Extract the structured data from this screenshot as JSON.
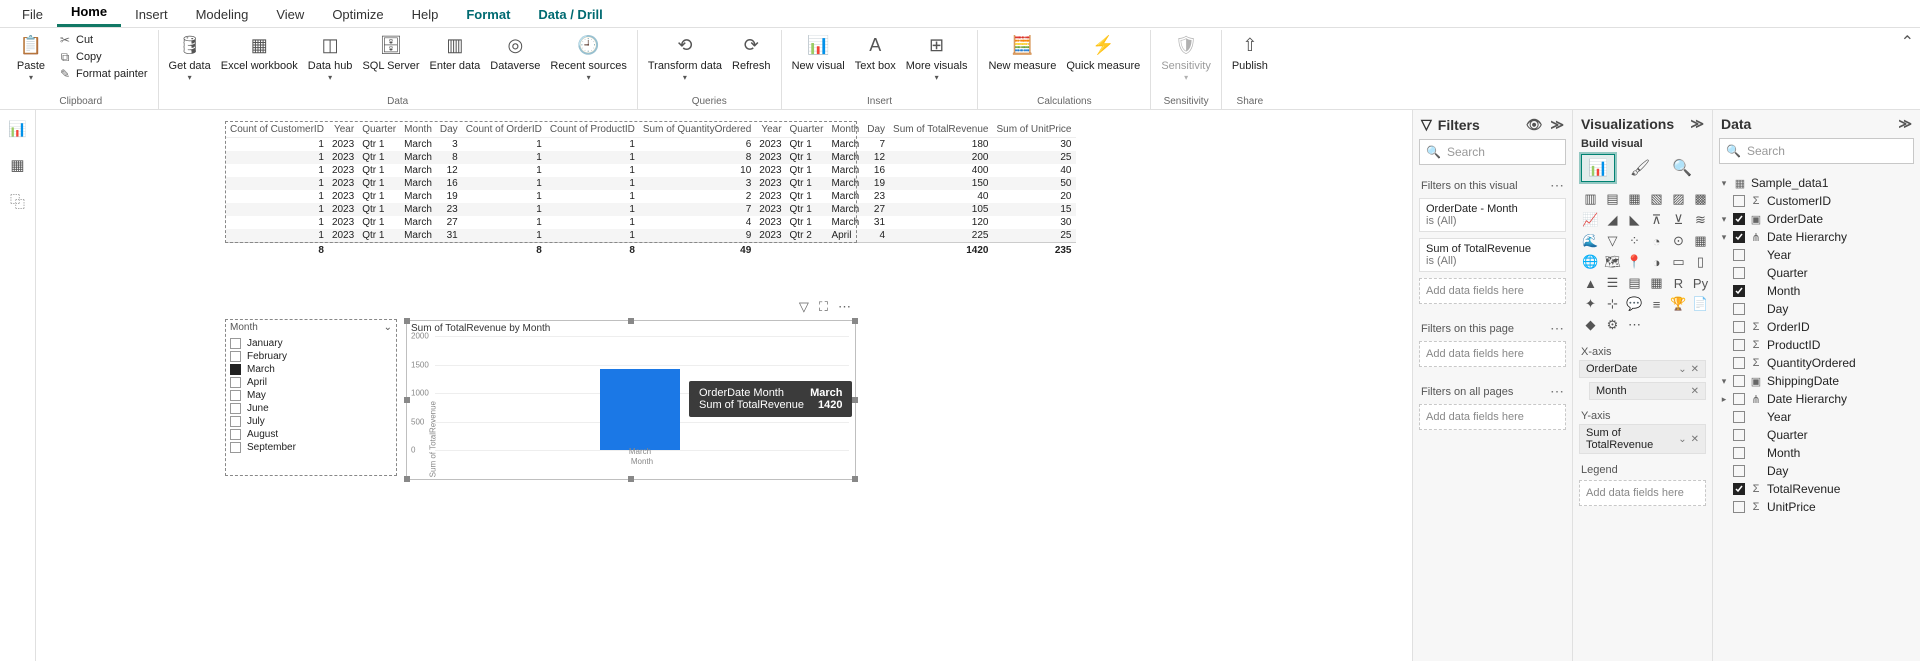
{
  "ribbon_tabs": {
    "file": "File",
    "home": "Home",
    "insert": "Insert",
    "modeling": "Modeling",
    "view": "View",
    "optimize": "Optimize",
    "help": "Help",
    "format": "Format",
    "data_drill": "Data / Drill"
  },
  "ribbon": {
    "paste": "Paste",
    "cut": "Cut",
    "copy": "Copy",
    "format_painter": "Format painter",
    "clipboard": "Clipboard",
    "get_data": "Get data",
    "excel": "Excel workbook",
    "data_hub": "Data hub",
    "sql_server": "SQL Server",
    "enter_data": "Enter data",
    "dataverse": "Dataverse",
    "recent_sources": "Recent sources",
    "data_group": "Data",
    "transform_data": "Transform data",
    "refresh": "Refresh",
    "queries": "Queries",
    "new_visual": "New visual",
    "text_box": "Text box",
    "more_visuals": "More visuals",
    "insert_group": "Insert",
    "new_measure": "New measure",
    "quick_measure": "Quick measure",
    "calculations": "Calculations",
    "sensitivity": "Sensitivity",
    "sensitivity_group": "Sensitivity",
    "publish": "Publish",
    "share": "Share"
  },
  "table_headers": {
    "count_customer": "Count of CustomerID",
    "year1": "Year",
    "quarter1": "Quarter",
    "month1": "Month",
    "day1": "Day",
    "count_order": "Count of OrderID",
    "count_product": "Count of ProductID",
    "sum_qty": "Sum of QuantityOrdered",
    "year2": "Year",
    "quarter2": "Quarter",
    "month2": "Month",
    "day2": "Day",
    "sum_rev": "Sum of TotalRevenue",
    "sum_unit": "Sum of UnitPrice"
  },
  "table_rows": [
    {
      "c1": "1",
      "y1": "2023",
      "q1": "Qtr 1",
      "m1": "March",
      "d1": "3",
      "c2": "1",
      "c3": "1",
      "sq": "6",
      "y2": "2023",
      "q2": "Qtr 1",
      "m2": "March",
      "d2": "7",
      "sr": "180",
      "su": "30"
    },
    {
      "c1": "1",
      "y1": "2023",
      "q1": "Qtr 1",
      "m1": "March",
      "d1": "8",
      "c2": "1",
      "c3": "1",
      "sq": "8",
      "y2": "2023",
      "q2": "Qtr 1",
      "m2": "March",
      "d2": "12",
      "sr": "200",
      "su": "25"
    },
    {
      "c1": "1",
      "y1": "2023",
      "q1": "Qtr 1",
      "m1": "March",
      "d1": "12",
      "c2": "1",
      "c3": "1",
      "sq": "10",
      "y2": "2023",
      "q2": "Qtr 1",
      "m2": "March",
      "d2": "16",
      "sr": "400",
      "su": "40"
    },
    {
      "c1": "1",
      "y1": "2023",
      "q1": "Qtr 1",
      "m1": "March",
      "d1": "16",
      "c2": "1",
      "c3": "1",
      "sq": "3",
      "y2": "2023",
      "q2": "Qtr 1",
      "m2": "March",
      "d2": "19",
      "sr": "150",
      "su": "50"
    },
    {
      "c1": "1",
      "y1": "2023",
      "q1": "Qtr 1",
      "m1": "March",
      "d1": "19",
      "c2": "1",
      "c3": "1",
      "sq": "2",
      "y2": "2023",
      "q2": "Qtr 1",
      "m2": "March",
      "d2": "23",
      "sr": "40",
      "su": "20"
    },
    {
      "c1": "1",
      "y1": "2023",
      "q1": "Qtr 1",
      "m1": "March",
      "d1": "23",
      "c2": "1",
      "c3": "1",
      "sq": "7",
      "y2": "2023",
      "q2": "Qtr 1",
      "m2": "March",
      "d2": "27",
      "sr": "105",
      "su": "15"
    },
    {
      "c1": "1",
      "y1": "2023",
      "q1": "Qtr 1",
      "m1": "March",
      "d1": "27",
      "c2": "1",
      "c3": "1",
      "sq": "4",
      "y2": "2023",
      "q2": "Qtr 1",
      "m2": "March",
      "d2": "31",
      "sr": "120",
      "su": "30"
    },
    {
      "c1": "1",
      "y1": "2023",
      "q1": "Qtr 1",
      "m1": "March",
      "d1": "31",
      "c2": "1",
      "c3": "1",
      "sq": "9",
      "y2": "2023",
      "q2": "Qtr 2",
      "m2": "April",
      "d2": "4",
      "sr": "225",
      "su": "25"
    }
  ],
  "table_totals": {
    "c1": "8",
    "c2": "8",
    "c3": "8",
    "sq": "49",
    "sr": "1420",
    "su": "235"
  },
  "slicer": {
    "title": "Month",
    "items": [
      {
        "label": "January",
        "checked": false
      },
      {
        "label": "February",
        "checked": false
      },
      {
        "label": "March",
        "checked": true
      },
      {
        "label": "April",
        "checked": false
      },
      {
        "label": "May",
        "checked": false
      },
      {
        "label": "June",
        "checked": false
      },
      {
        "label": "July",
        "checked": false
      },
      {
        "label": "August",
        "checked": false
      },
      {
        "label": "September",
        "checked": false
      }
    ]
  },
  "chart_data": {
    "type": "bar",
    "title": "Sum of TotalRevenue by Month",
    "categories": [
      "March"
    ],
    "values": [
      1420
    ],
    "xlabel": "Month",
    "ylabel": "Sum of TotalRevenue",
    "yticks": [
      0,
      500,
      1000,
      1500,
      2000
    ],
    "ylim": [
      0,
      2000
    ],
    "tooltip": {
      "label1": "OrderDate Month",
      "value1": "March",
      "label2": "Sum of TotalRevenue",
      "value2": "1420"
    }
  },
  "filters": {
    "title": "Filters",
    "search_placeholder": "Search",
    "on_visual": "Filters on this visual",
    "card1_title": "OrderDate - Month",
    "card1_sub": "is (All)",
    "card2_title": "Sum of TotalRevenue",
    "card2_sub": "is (All)",
    "add_here": "Add data fields here",
    "on_page": "Filters on this page",
    "on_all": "Filters on all pages"
  },
  "viz": {
    "title": "Visualizations",
    "build": "Build visual",
    "xaxis": "X-axis",
    "yaxis": "Y-axis",
    "legend": "Legend",
    "orderdate": "OrderDate",
    "month": "Month",
    "sum_rev": "Sum of TotalRevenue",
    "add_here": "Add data fields here"
  },
  "data": {
    "title": "Data",
    "search_placeholder": "Search",
    "table": "Sample_data1",
    "customer_id": "CustomerID",
    "order_date": "OrderDate",
    "date_hierarchy": "Date Hierarchy",
    "year": "Year",
    "quarter": "Quarter",
    "month": "Month",
    "day": "Day",
    "order_id": "OrderID",
    "product_id": "ProductID",
    "qty_ordered": "QuantityOrdered",
    "shipping_date": "ShippingDate",
    "total_revenue": "TotalRevenue",
    "unit_price": "UnitPrice"
  }
}
